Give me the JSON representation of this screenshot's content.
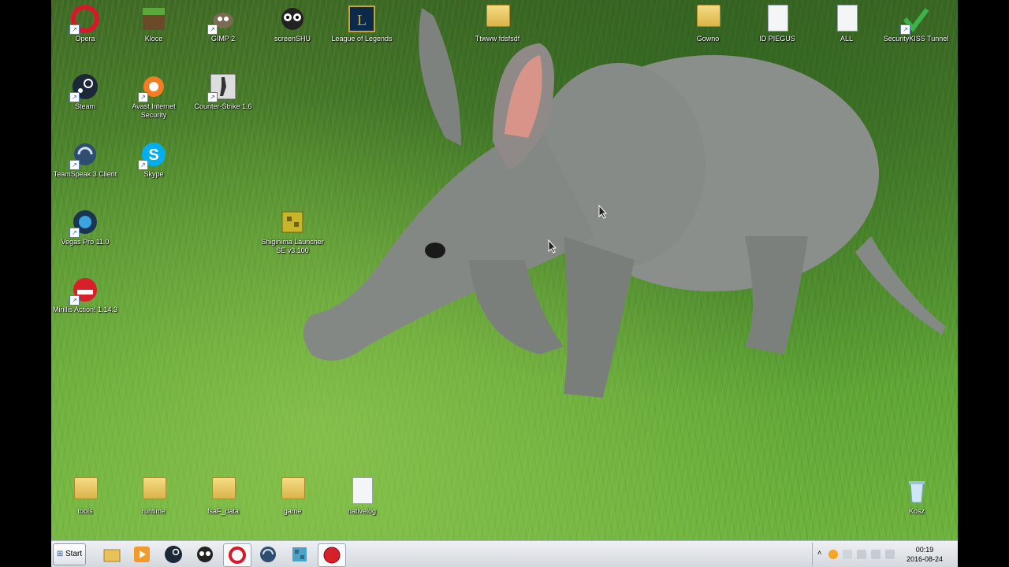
{
  "desktop": {
    "icons": [
      {
        "label": "Opera"
      },
      {
        "label": "Kloce"
      },
      {
        "label": "GIMP 2"
      },
      {
        "label": "screenSHU"
      },
      {
        "label": "League of Legends"
      },
      {
        "label": "Ttwww fdsfsdf"
      },
      {
        "label": "Gowno"
      },
      {
        "label": "ID PIEGUS"
      },
      {
        "label": "ALL"
      },
      {
        "label": "SecurityKISS Tunnel"
      },
      {
        "label": "Steam"
      },
      {
        "label": "Avast Internet Security"
      },
      {
        "label": "Counter-Strike 1.6"
      },
      {
        "label": "TeamSpeak 3 Client"
      },
      {
        "label": "Skype"
      },
      {
        "label": "Vegas Pro 11.0"
      },
      {
        "label": "Shiginima Launcher SE v3.100"
      },
      {
        "label": "Mirillis Action! 1.14.3"
      },
      {
        "label": "tools"
      },
      {
        "label": "runtime"
      },
      {
        "label": "fsaF_data"
      },
      {
        "label": "game"
      },
      {
        "label": "nativelog"
      },
      {
        "label": "Kosz"
      }
    ]
  },
  "taskbar": {
    "start_label": "Start",
    "pinned": [
      "explorer-icon",
      "media-player-icon",
      "steam-icon",
      "screenshu-icon",
      "opera-icon",
      "teamspeak-icon",
      "minecraft-icon",
      "record-icon"
    ],
    "clock_time": "00:19",
    "clock_date": "2016-08-24"
  },
  "colors": {
    "accent": "#2a57a8",
    "taskbar": "#dfe3e9"
  }
}
